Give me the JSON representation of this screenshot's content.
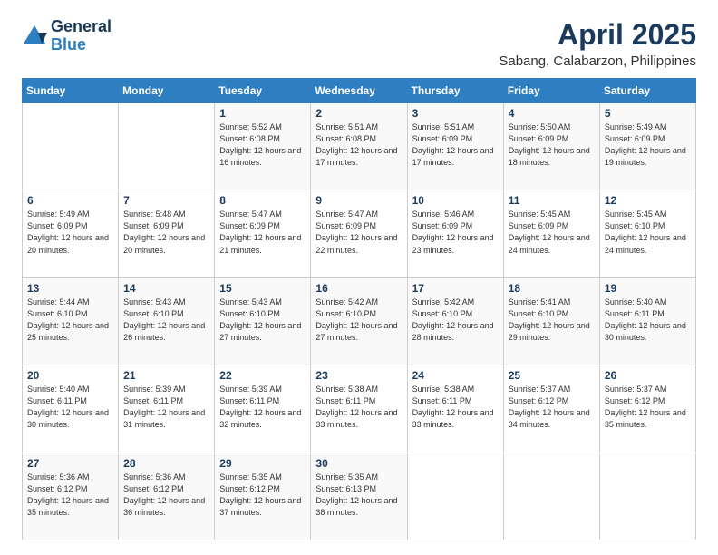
{
  "header": {
    "logo": {
      "line1": "General",
      "line2": "Blue"
    },
    "title": "April 2025",
    "location": "Sabang, Calabarzon, Philippines"
  },
  "weekdays": [
    "Sunday",
    "Monday",
    "Tuesday",
    "Wednesday",
    "Thursday",
    "Friday",
    "Saturday"
  ],
  "weeks": [
    [
      {
        "day": "",
        "info": ""
      },
      {
        "day": "",
        "info": ""
      },
      {
        "day": "1",
        "info": "Sunrise: 5:52 AM\nSunset: 6:08 PM\nDaylight: 12 hours and 16 minutes."
      },
      {
        "day": "2",
        "info": "Sunrise: 5:51 AM\nSunset: 6:08 PM\nDaylight: 12 hours and 17 minutes."
      },
      {
        "day": "3",
        "info": "Sunrise: 5:51 AM\nSunset: 6:09 PM\nDaylight: 12 hours and 17 minutes."
      },
      {
        "day": "4",
        "info": "Sunrise: 5:50 AM\nSunset: 6:09 PM\nDaylight: 12 hours and 18 minutes."
      },
      {
        "day": "5",
        "info": "Sunrise: 5:49 AM\nSunset: 6:09 PM\nDaylight: 12 hours and 19 minutes."
      }
    ],
    [
      {
        "day": "6",
        "info": "Sunrise: 5:49 AM\nSunset: 6:09 PM\nDaylight: 12 hours and 20 minutes."
      },
      {
        "day": "7",
        "info": "Sunrise: 5:48 AM\nSunset: 6:09 PM\nDaylight: 12 hours and 20 minutes."
      },
      {
        "day": "8",
        "info": "Sunrise: 5:47 AM\nSunset: 6:09 PM\nDaylight: 12 hours and 21 minutes."
      },
      {
        "day": "9",
        "info": "Sunrise: 5:47 AM\nSunset: 6:09 PM\nDaylight: 12 hours and 22 minutes."
      },
      {
        "day": "10",
        "info": "Sunrise: 5:46 AM\nSunset: 6:09 PM\nDaylight: 12 hours and 23 minutes."
      },
      {
        "day": "11",
        "info": "Sunrise: 5:45 AM\nSunset: 6:09 PM\nDaylight: 12 hours and 24 minutes."
      },
      {
        "day": "12",
        "info": "Sunrise: 5:45 AM\nSunset: 6:10 PM\nDaylight: 12 hours and 24 minutes."
      }
    ],
    [
      {
        "day": "13",
        "info": "Sunrise: 5:44 AM\nSunset: 6:10 PM\nDaylight: 12 hours and 25 minutes."
      },
      {
        "day": "14",
        "info": "Sunrise: 5:43 AM\nSunset: 6:10 PM\nDaylight: 12 hours and 26 minutes."
      },
      {
        "day": "15",
        "info": "Sunrise: 5:43 AM\nSunset: 6:10 PM\nDaylight: 12 hours and 27 minutes."
      },
      {
        "day": "16",
        "info": "Sunrise: 5:42 AM\nSunset: 6:10 PM\nDaylight: 12 hours and 27 minutes."
      },
      {
        "day": "17",
        "info": "Sunrise: 5:42 AM\nSunset: 6:10 PM\nDaylight: 12 hours and 28 minutes."
      },
      {
        "day": "18",
        "info": "Sunrise: 5:41 AM\nSunset: 6:10 PM\nDaylight: 12 hours and 29 minutes."
      },
      {
        "day": "19",
        "info": "Sunrise: 5:40 AM\nSunset: 6:11 PM\nDaylight: 12 hours and 30 minutes."
      }
    ],
    [
      {
        "day": "20",
        "info": "Sunrise: 5:40 AM\nSunset: 6:11 PM\nDaylight: 12 hours and 30 minutes."
      },
      {
        "day": "21",
        "info": "Sunrise: 5:39 AM\nSunset: 6:11 PM\nDaylight: 12 hours and 31 minutes."
      },
      {
        "day": "22",
        "info": "Sunrise: 5:39 AM\nSunset: 6:11 PM\nDaylight: 12 hours and 32 minutes."
      },
      {
        "day": "23",
        "info": "Sunrise: 5:38 AM\nSunset: 6:11 PM\nDaylight: 12 hours and 33 minutes."
      },
      {
        "day": "24",
        "info": "Sunrise: 5:38 AM\nSunset: 6:11 PM\nDaylight: 12 hours and 33 minutes."
      },
      {
        "day": "25",
        "info": "Sunrise: 5:37 AM\nSunset: 6:12 PM\nDaylight: 12 hours and 34 minutes."
      },
      {
        "day": "26",
        "info": "Sunrise: 5:37 AM\nSunset: 6:12 PM\nDaylight: 12 hours and 35 minutes."
      }
    ],
    [
      {
        "day": "27",
        "info": "Sunrise: 5:36 AM\nSunset: 6:12 PM\nDaylight: 12 hours and 35 minutes."
      },
      {
        "day": "28",
        "info": "Sunrise: 5:36 AM\nSunset: 6:12 PM\nDaylight: 12 hours and 36 minutes."
      },
      {
        "day": "29",
        "info": "Sunrise: 5:35 AM\nSunset: 6:12 PM\nDaylight: 12 hours and 37 minutes."
      },
      {
        "day": "30",
        "info": "Sunrise: 5:35 AM\nSunset: 6:13 PM\nDaylight: 12 hours and 38 minutes."
      },
      {
        "day": "",
        "info": ""
      },
      {
        "day": "",
        "info": ""
      },
      {
        "day": "",
        "info": ""
      }
    ]
  ]
}
